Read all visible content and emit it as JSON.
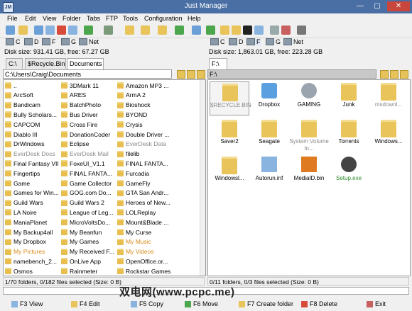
{
  "window": {
    "title": "Just Manager",
    "controls": [
      "—",
      "▢",
      "✕"
    ]
  },
  "menu": [
    "File",
    "Edit",
    "View",
    "Folder",
    "Tabs",
    "FTP",
    "Tools",
    "Configuration",
    "Help"
  ],
  "left": {
    "drives": [
      "C",
      "D",
      "F",
      "G",
      "Net"
    ],
    "disk": "Disk size: 931.41 GB, free: 67.27 GB",
    "tabs": [
      "C:\\",
      "$Recycle.Bin",
      "Documents"
    ],
    "path": "C:\\Users\\Craig\\Documents",
    "col1": [
      "..",
      "ArcSoft",
      "Bandicam",
      "Bully Scholars...",
      "CAPCOM",
      "Diablo III",
      "DrWindows",
      "EverDesk Docs",
      "Final Fantasy VII",
      "Fingertips",
      "Game",
      "Games for Win...",
      "Guild Wars",
      "LA Noire",
      "ManiaPlanet",
      "My Backup4all",
      "My Dropbox",
      "My Pictures",
      "namebench_2...",
      "Osmos"
    ],
    "col2": [
      "3DMark 11",
      "ARES",
      "BatchPhoto",
      "Bus Driver",
      "Cross Fire",
      "DonationCoder",
      "Eclipse",
      "EverDesk Mail",
      "FoxeUI_V1.1",
      "FINAL FANTA...",
      "Game Collector",
      "GOG.com Do...",
      "Guild Wars 2",
      "League of Leg...",
      "MicroVoltsDo...",
      "My Beanfun",
      "My Games",
      "My Received F...",
      "OnLive App",
      "Rainmeter"
    ],
    "col3": [
      "Amazon MP3 ...",
      "ArmA 2",
      "Bioshock",
      "BYOND",
      "Crysis",
      "Double Driver ...",
      "EverDesk Data",
      "filelib",
      "FINAL FANTA...",
      "Furcadia",
      "GameFly",
      "GTA San Andr...",
      "Heroes of New...",
      "LOLReplay",
      "Mount&Blade ...",
      "My Curse",
      "My Music",
      "My Videos",
      "OpenOffice.or...",
      "Rockstar Games"
    ],
    "status": "1/70 folders, 0/182 files selected (Size: 0 B)"
  },
  "right": {
    "drives": [
      "C",
      "D",
      "F",
      "G",
      "Net"
    ],
    "disk": "Disk size: 1,863.01 GB, free: 223.28 GB",
    "tabs": [
      "F:\\"
    ],
    "path": "F:\\",
    "items": [
      "$RECYCLE.BIN",
      "Dropbox",
      "GAMING",
      "Junk",
      "msdownl...",
      "Saver2",
      "Seagate",
      "System Volume In...",
      "Torrents",
      "Windows...",
      "Windowsl...",
      "Autorun.inf",
      "MediaID.bin",
      "Setup.exe"
    ],
    "status": "0/11 folders, 0/3 files selected (Size: 0 B)"
  },
  "fkeys": [
    "F3 View",
    "F4 Edit",
    "F5 Copy",
    "F6 Move",
    "F7 Create folder",
    "F8 Delete",
    "Exit"
  ],
  "watermark": "双电网(www.pcpc.me)",
  "colors": {
    "titlebar": "#4a6fa5",
    "folder": "#e8c45a",
    "hidden_text": "#8a8a8a",
    "special_text": "#d98a1a",
    "exe_text": "#2e8b2e"
  }
}
